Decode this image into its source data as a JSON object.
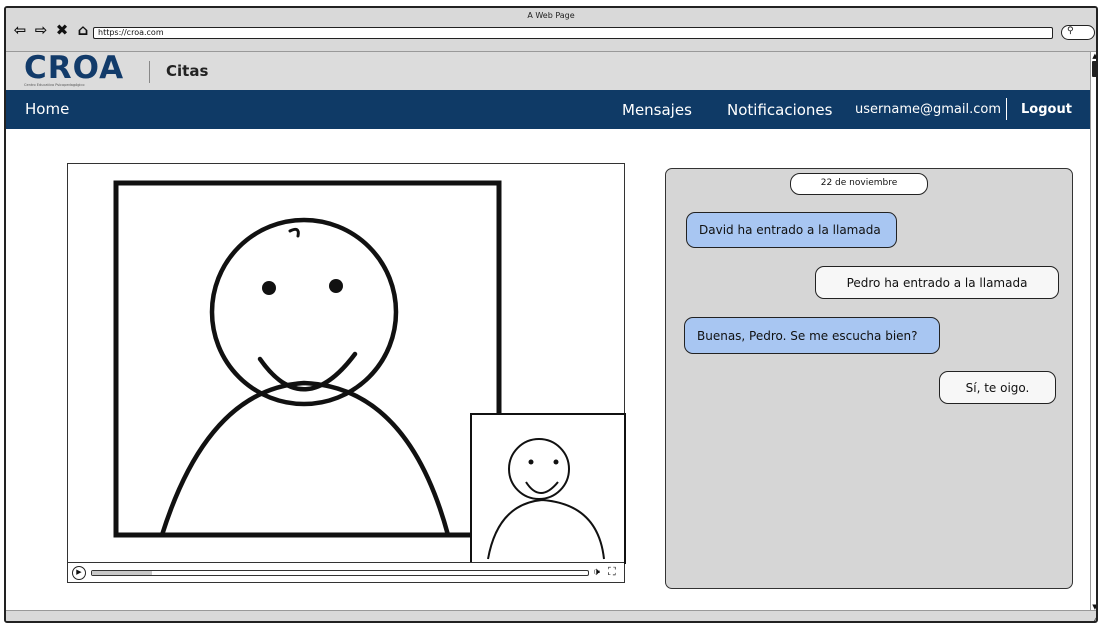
{
  "browser": {
    "window_title": "A Web Page",
    "url": "https://croa.com",
    "icons": [
      "back-icon",
      "forward-icon",
      "close-icon",
      "home-icon",
      "search-icon"
    ]
  },
  "header": {
    "logo_text": "CROA",
    "logo_subtitle": "Centro Educativo Psicopedagógico",
    "section_title": "Citas"
  },
  "nav": {
    "home": "Home",
    "messages": "Mensajes",
    "notifications": "Notificaciones",
    "user_email": "username@gmail.com",
    "logout": "Logout"
  },
  "video": {
    "progress": 0.12,
    "icons": [
      "play-icon",
      "volume-icon",
      "fullscreen-icon"
    ]
  },
  "chat": {
    "date": "22 de noviembre",
    "messages": [
      {
        "side": "left",
        "text": "David ha entrado a la llamada"
      },
      {
        "side": "right",
        "text": "Pedro ha entrado a la llamada"
      },
      {
        "side": "left",
        "text": "Buenas, Pedro. Se me escucha bien?"
      },
      {
        "side": "right",
        "text": "Sí, te oigo."
      }
    ]
  },
  "colors": {
    "navbar": "#0f3a66",
    "bubble_left": "#a8c6f2",
    "bubble_right": "#f7f7f7",
    "chat_panel": "#d6d6d6"
  }
}
